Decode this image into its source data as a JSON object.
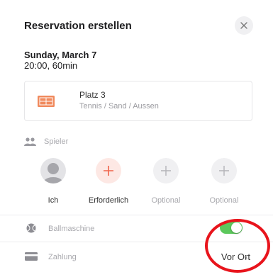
{
  "header": {
    "title": "Reservation erstellen",
    "close_icon": "close-icon"
  },
  "booking": {
    "date": "Sunday, March 7",
    "time": "20:00, 60min"
  },
  "court": {
    "name": "Platz 3",
    "description": "Tennis / Sand / Aussen",
    "icon": "court-icon",
    "icon_color": "#f08a5d"
  },
  "players": {
    "label": "Spieler",
    "icon": "people-icon",
    "slots": [
      {
        "label": "Ich",
        "type": "avatar"
      },
      {
        "label": "Erforderlich",
        "type": "required"
      },
      {
        "label": "Optional",
        "type": "optional"
      },
      {
        "label": "Optional",
        "type": "optional"
      }
    ]
  },
  "ball_machine": {
    "label": "Ballmaschine",
    "icon": "ball-icon",
    "enabled": true,
    "toggle_color": "#5cc85c"
  },
  "payment": {
    "label": "Zahlung",
    "icon": "card-icon",
    "value": "Vor Ort"
  },
  "colors": {
    "required_bg": "#fde8e4",
    "required_plus": "#f0634a",
    "annotation": "#e8141c"
  }
}
